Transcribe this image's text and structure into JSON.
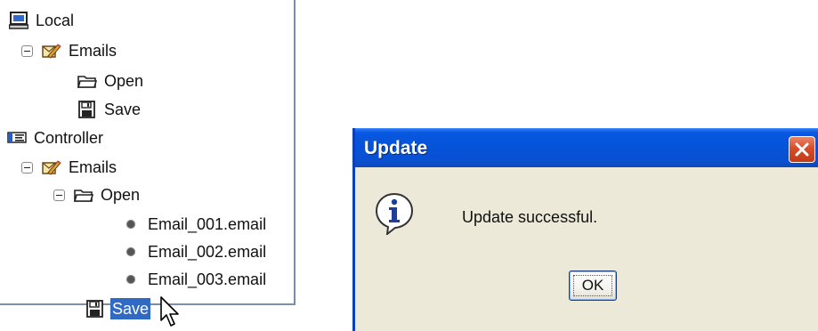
{
  "tree": {
    "local": {
      "label": "Local",
      "icon": "computer-icon"
    },
    "local_emails": {
      "label": "Emails",
      "icon": "email-pencil-icon"
    },
    "local_open": {
      "label": "Open",
      "icon": "open-folder-icon"
    },
    "local_save": {
      "label": "Save",
      "icon": "floppy-disk-icon"
    },
    "controller": {
      "label": "Controller",
      "icon": "controller-icon"
    },
    "controller_emails": {
      "label": "Emails",
      "icon": "email-pencil-icon"
    },
    "controller_open": {
      "label": "Open",
      "icon": "open-folder-icon"
    },
    "files": [
      {
        "label": "Email_001.email"
      },
      {
        "label": "Email_002.email"
      },
      {
        "label": "Email_003.email"
      }
    ],
    "controller_save": {
      "label": "Save",
      "icon": "floppy-disk-icon",
      "selected": true
    }
  },
  "dialog": {
    "title": "Update",
    "message": "Update successful.",
    "ok_label": "OK",
    "icon": "info-icon"
  },
  "colors": {
    "titlebar": "#0553d8",
    "dialog_bg": "#ece9d8",
    "selection": "#316ac5",
    "close": "#d84d2a"
  }
}
